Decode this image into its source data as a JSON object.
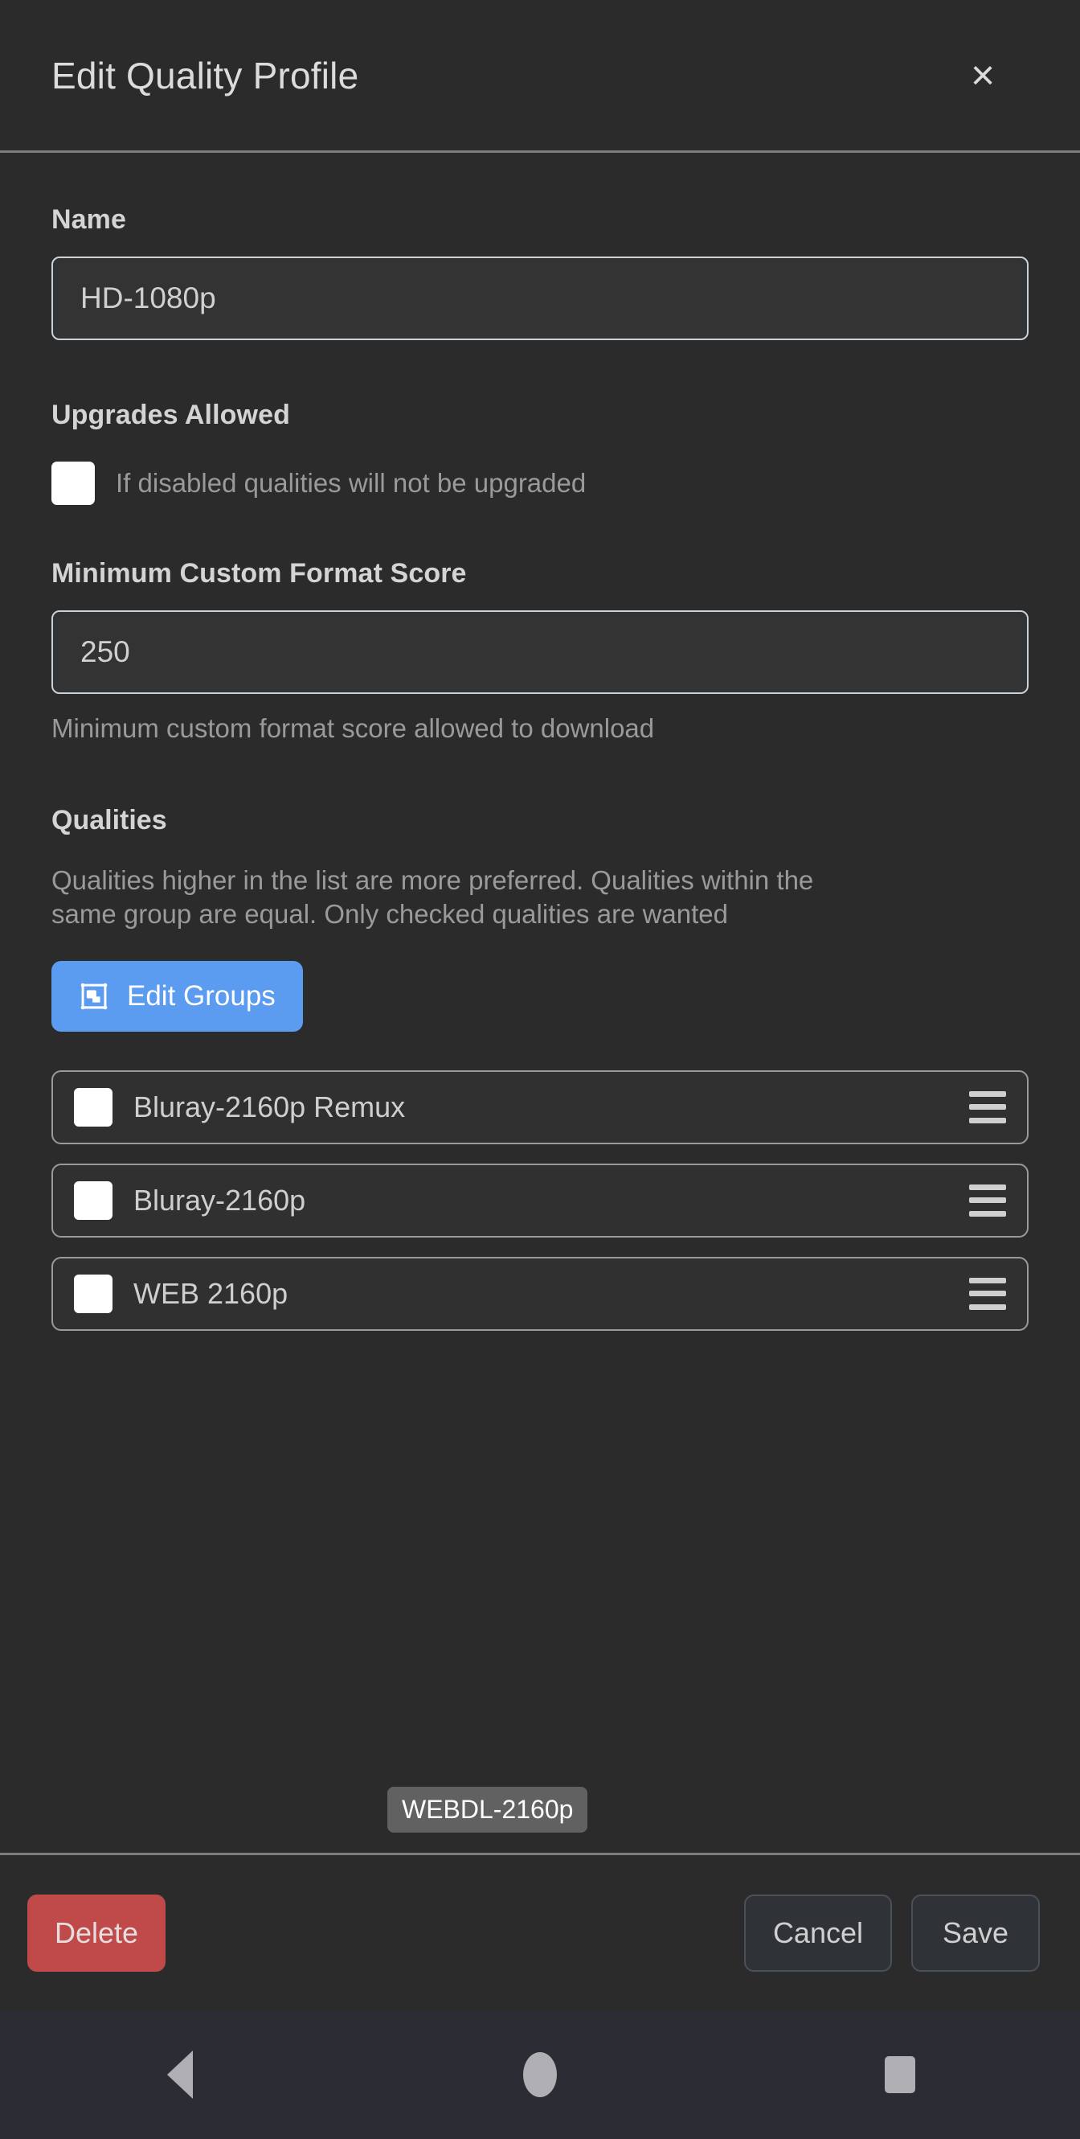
{
  "header": {
    "title": "Edit Quality Profile",
    "close_icon": "close-icon",
    "close_glyph": "×"
  },
  "form": {
    "name": {
      "label": "Name",
      "value": "HD-1080p",
      "placeholder": "Name"
    },
    "upgrades_allowed": {
      "label": "Upgrades Allowed",
      "checkbox_label": "If disabled qualities will not be upgraded",
      "checked": false
    },
    "minimum_custom_format_score": {
      "label": "Minimum Custom Format Score",
      "value": "250",
      "placeholder": "0",
      "help": "Minimum custom format score allowed to download"
    },
    "qualities": {
      "label": "Qualities",
      "help": "Qualities higher in the list are more preferred. Qualities within the same group are equal. Only checked qualities are wanted",
      "edit_groups_button": "Edit Groups",
      "edit_groups_icon": "group-objects-icon",
      "items": [
        {
          "name": "Bluray-2160p Remux",
          "checked": false,
          "handle_icon": "drag-handle-icon"
        },
        {
          "name": "Bluray-2160p",
          "checked": false,
          "handle_icon": "drag-handle-icon"
        },
        {
          "name": "WEB 2160p",
          "checked": false,
          "handle_icon": "drag-handle-icon"
        }
      ],
      "drag_tooltip": "WEBDL-2160p"
    }
  },
  "footer": {
    "delete_label": "Delete",
    "cancel_label": "Cancel",
    "save_label": "Save"
  },
  "navbar": {
    "back_icon": "back-triangle-icon",
    "home_icon": "home-circle-icon",
    "recents_icon": "recents-square-icon"
  },
  "colors": {
    "background": "#2b2b2b",
    "accent_blue": "#5b9bf0",
    "delete_red": "#c04a4a",
    "text_primary": "#d4d4d4",
    "text_muted": "#9a9a9a",
    "navbar_bg": "#2c2c34"
  }
}
